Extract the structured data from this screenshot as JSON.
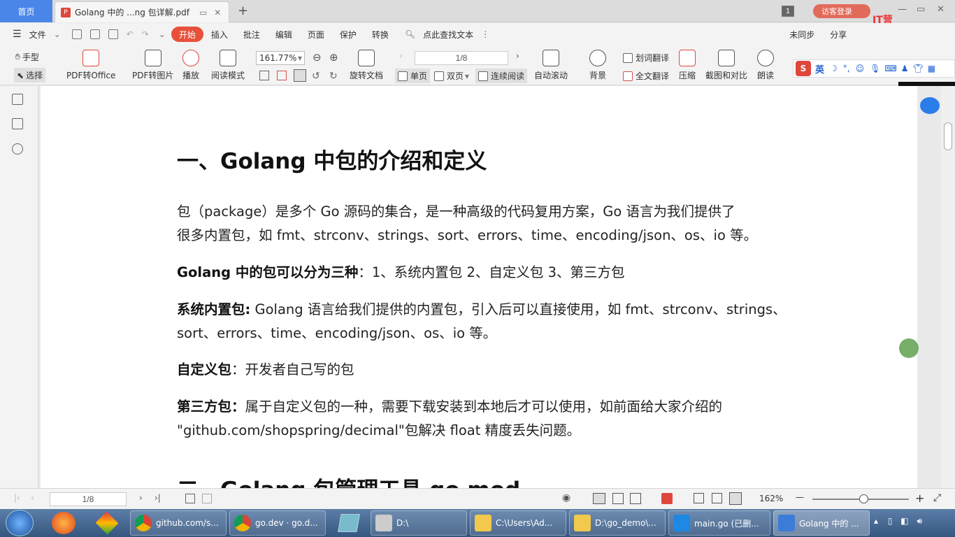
{
  "titlebar": {
    "home_tab": "首页",
    "doc_tab_title": "Golang 中的 ...ng 包详解.pdf",
    "new_tab": "+",
    "tab_count": "1",
    "login": "访客登录",
    "watermark": "IT营(itying.com)"
  },
  "menubar": {
    "file": "文件",
    "items": [
      "开始",
      "插入",
      "批注",
      "编辑",
      "页面",
      "保护",
      "转换"
    ],
    "search": "点此查找文本",
    "share": "分享",
    "collab": "未同步"
  },
  "toolbar": {
    "hand": "手型",
    "select": "选择",
    "pdf_to_office": "PDF转Office",
    "pdf_to_image": "PDF转图片",
    "play": "播放",
    "read_mode": "阅读模式",
    "zoom": "161.77%",
    "rotate": "旋转文档",
    "page_value": "1/8",
    "single": "单页",
    "double": "双页",
    "continuous": "连续阅读",
    "auto_scroll": "自动滚动",
    "background": "背景",
    "word_translate": "划词翻译",
    "full_translate": "全文翻译",
    "compress": "压缩",
    "screenshot": "截图和对比",
    "read_aloud": "朗读"
  },
  "ime": {
    "lang": "英"
  },
  "document": {
    "h1": "一、Golang 中包的介绍和定义",
    "p1_line1": "包（package）是多个 Go 源码的集合，是一种高级的代码复用方案，Go 语言为我们提供了",
    "p1_line2": "很多内置包，如 fmt、strconv、strings、sort、errors、time、encoding/json、os、io 等。",
    "p2_bold": "Golang 中的包可以分为三种",
    "p2_rest": "：1、系统内置包   2、自定义包  3、第三方包",
    "p3_bold": "系统内置包:",
    "p3_line1": " Golang 语言给我们提供的内置包，引入后可以直接使用，如 fmt、strconv、strings、",
    "p3_line2": "sort、errors、time、encoding/json、os、io 等。",
    "p4_bold": "自定义包",
    "p4_rest": "：开发者自己写的包",
    "p5_bold": "第三方包：",
    "p5_line1": "属于自定义包的一种，需要下载安装到本地后才可以使用，如前面给大家介绍的",
    "p5_line2": "\"github.com/shopspring/decimal\"包解决 float 精度丢失问题。",
    "h2": "二、Golang 包管理工具 go mod"
  },
  "statusbar": {
    "page_value": "1/8",
    "zoom": "162%"
  },
  "taskbar": {
    "items": [
      "github.com/s...",
      "go.dev · go.d...",
      "D:\\",
      "C:\\Users\\Ad...",
      "D:\\go_demo\\...",
      "main.go (已删...",
      "Golang 中的 ..."
    ]
  },
  "colors": {
    "accent": "#e8503a",
    "home_tab": "#4a86e8",
    "taskbar": "#35567e"
  }
}
